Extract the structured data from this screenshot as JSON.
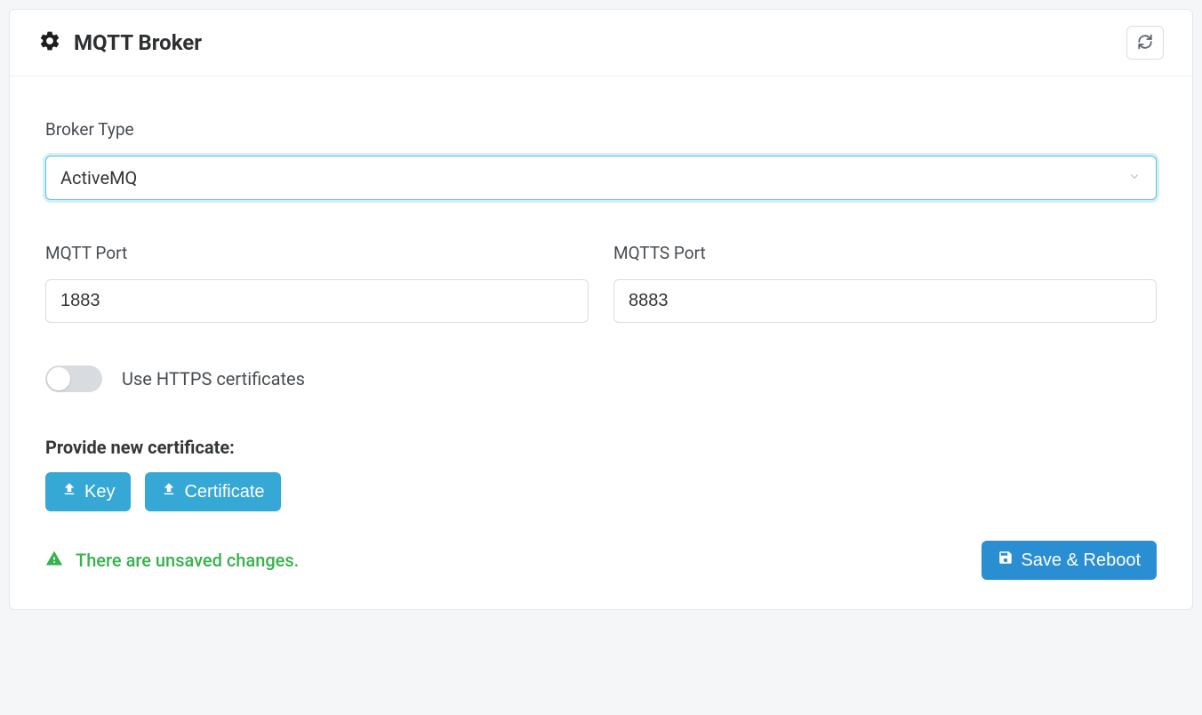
{
  "header": {
    "title": "MQTT Broker"
  },
  "form": {
    "broker_type_label": "Broker Type",
    "broker_type_value": "ActiveMQ",
    "mqtt_port_label": "MQTT Port",
    "mqtt_port_value": "1883",
    "mqtts_port_label": "MQTTS Port",
    "mqtts_port_value": "8883",
    "use_https_cert_label": "Use HTTPS certificates",
    "use_https_cert_value": false,
    "cert_heading": "Provide new certificate:",
    "key_button": "Key",
    "cert_button": "Certificate"
  },
  "footer": {
    "unsaved_message": "There are unsaved changes.",
    "save_button": "Save & Reboot"
  },
  "colors": {
    "accent": "#36a8d6",
    "primary": "#2a8ed3",
    "success": "#37b24d"
  }
}
